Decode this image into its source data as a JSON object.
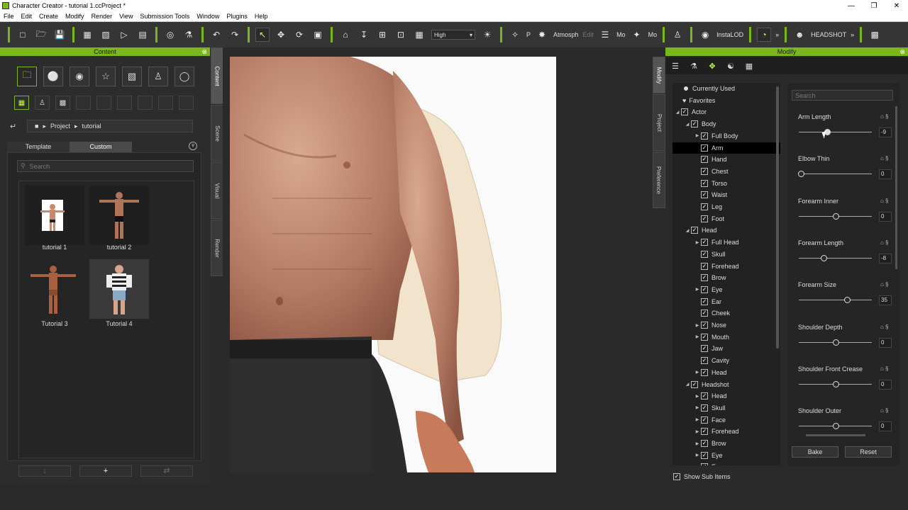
{
  "window": {
    "title": "Character Creator - tutorial 1.ccProject *"
  },
  "menu": [
    "File",
    "Edit",
    "Create",
    "Modify",
    "Render",
    "View",
    "Submission Tools",
    "Window",
    "Plugins",
    "Help"
  ],
  "toolbar": {
    "quality": "High",
    "p_label": "P",
    "atmosphere": "Atmosph",
    "edit": "Edit",
    "mo1": "Mo",
    "mo2": "Mo",
    "instalod": "InstaLOD",
    "headshot": "HEADSHOT"
  },
  "content": {
    "header": "Content",
    "path": [
      "Project",
      "tutorial"
    ],
    "tabs": [
      "Template",
      "Custom"
    ],
    "active_tab": "Custom",
    "search_placeholder": "Search",
    "items": [
      "tutorial 1",
      "tutorial 2",
      "Tutorial 3",
      "Tutorial 4"
    ],
    "side_tabs": [
      "Content",
      "Scene",
      "Visual",
      "Render"
    ]
  },
  "modify": {
    "header": "Modify",
    "side_tabs": [
      "Modify",
      "Project",
      "Preference"
    ],
    "search_placeholder": "Search",
    "tree": [
      {
        "label": "Currently Used",
        "type": "dot",
        "level": 0
      },
      {
        "label": "Favorites",
        "type": "heart",
        "level": 0
      },
      {
        "label": "Actor",
        "type": "cb",
        "level": 0,
        "open": true
      },
      {
        "label": "Body",
        "type": "cb",
        "level": 1,
        "open": true
      },
      {
        "label": "Full Body",
        "type": "cb",
        "level": 2,
        "arrow": true
      },
      {
        "label": "Arm",
        "type": "cb",
        "level": 2,
        "selected": true
      },
      {
        "label": "Hand",
        "type": "cb",
        "level": 2
      },
      {
        "label": "Chest",
        "type": "cb",
        "level": 2
      },
      {
        "label": "Torso",
        "type": "cb",
        "level": 2
      },
      {
        "label": "Waist",
        "type": "cb",
        "level": 2
      },
      {
        "label": "Leg",
        "type": "cb",
        "level": 2
      },
      {
        "label": "Foot",
        "type": "cb",
        "level": 2
      },
      {
        "label": "Head",
        "type": "cb",
        "level": 1,
        "open": true
      },
      {
        "label": "Full Head",
        "type": "cb",
        "level": 2,
        "arrow": true
      },
      {
        "label": "Skull",
        "type": "cb",
        "level": 2
      },
      {
        "label": "Forehead",
        "type": "cb",
        "level": 2
      },
      {
        "label": "Brow",
        "type": "cb",
        "level": 2
      },
      {
        "label": "Eye",
        "type": "cb",
        "level": 2,
        "arrow": true
      },
      {
        "label": "Ear",
        "type": "cb",
        "level": 2
      },
      {
        "label": "Cheek",
        "type": "cb",
        "level": 2
      },
      {
        "label": "Nose",
        "type": "cb",
        "level": 2,
        "arrow": true
      },
      {
        "label": "Mouth",
        "type": "cb",
        "level": 2,
        "arrow": true
      },
      {
        "label": "Jaw",
        "type": "cb",
        "level": 2
      },
      {
        "label": "Cavity",
        "type": "cb",
        "level": 2
      },
      {
        "label": "Head",
        "type": "cb",
        "level": 2,
        "arrow": true
      },
      {
        "label": "Headshot",
        "type": "cb",
        "level": 1,
        "open": true
      },
      {
        "label": "Head",
        "type": "cb",
        "level": 2,
        "arrow": true
      },
      {
        "label": "Skull",
        "type": "cb",
        "level": 2,
        "arrow": true
      },
      {
        "label": "Face",
        "type": "cb",
        "level": 2,
        "arrow": true
      },
      {
        "label": "Forehead",
        "type": "cb",
        "level": 2,
        "arrow": true
      },
      {
        "label": "Brow",
        "type": "cb",
        "level": 2,
        "arrow": true
      },
      {
        "label": "Eye",
        "type": "cb",
        "level": 2,
        "arrow": true
      },
      {
        "label": "Ear",
        "type": "cb",
        "level": 2,
        "arrow": true
      }
    ],
    "sliders": [
      {
        "label": "Arm Length",
        "value": "-9",
        "pos": 0.38
      },
      {
        "label": "Elbow Thin",
        "value": "0",
        "pos": 0.0
      },
      {
        "label": "Forearm Inner",
        "value": "0",
        "pos": 0.5
      },
      {
        "label": "Forearm Length",
        "value": "-8",
        "pos": 0.33
      },
      {
        "label": "Forearm Size",
        "value": "35",
        "pos": 0.66
      },
      {
        "label": "Shoulder Depth",
        "value": "0",
        "pos": 0.5
      },
      {
        "label": "Shoulder Front Crease",
        "value": "0",
        "pos": 0.5
      },
      {
        "label": "Shoulder Outer",
        "value": "0",
        "pos": 0.5
      }
    ],
    "bake": "Bake",
    "reset": "Reset",
    "show_sub_items": "Show Sub Items"
  },
  "colors": {
    "accent": "#7bb61c",
    "highlight": "#c8ff3d"
  }
}
